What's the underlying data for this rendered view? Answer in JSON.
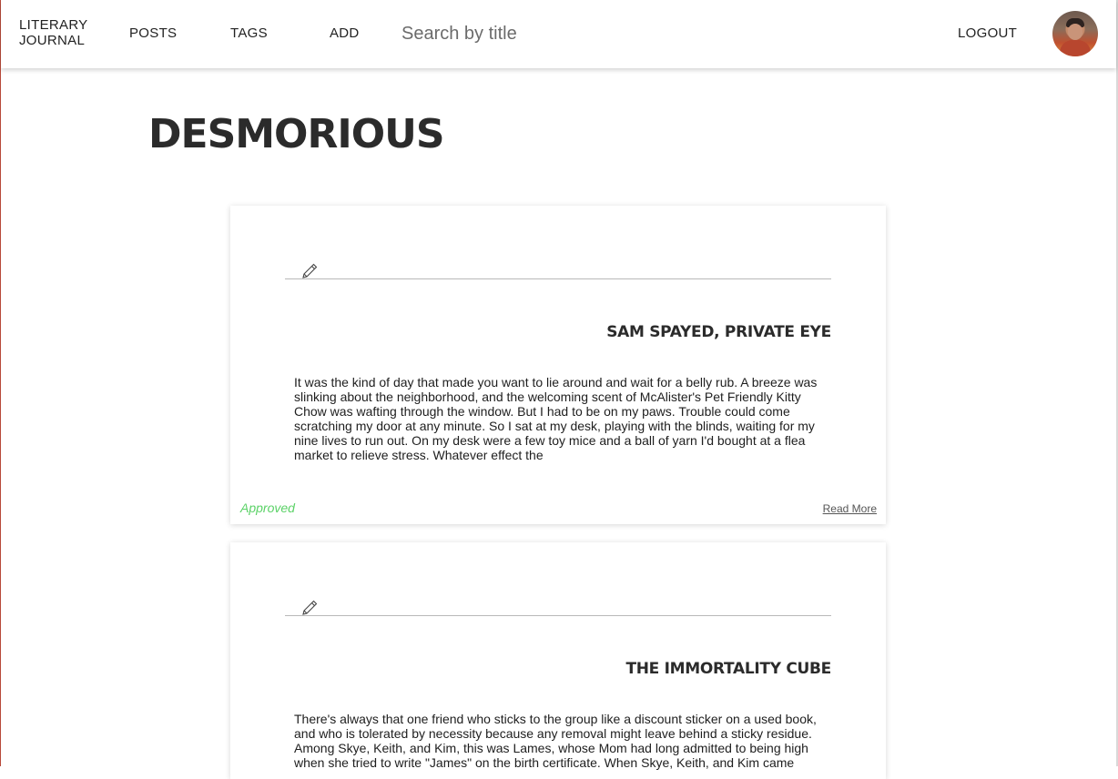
{
  "nav": {
    "brand": "LITERARY JOURNAL",
    "links": [
      {
        "label": "POSTS"
      },
      {
        "label": "TAGS"
      },
      {
        "label": "ADD"
      }
    ],
    "search_placeholder": "Search by title",
    "logout_label": "LOGOUT",
    "avatar_icon": "user-avatar"
  },
  "main": {
    "page_title": "DESMORIOUS"
  },
  "posts": [
    {
      "edit_icon": "pencil-icon",
      "title": "SAM SPAYED, PRIVATE EYE",
      "excerpt": "It was the kind of day that made you want to lie around and wait for a belly rub. A breeze was slinking about the neighborhood, and the welcoming scent of McAlister's Pet Friendly Kitty Chow was wafting through the window. But I had to be on my paws. Trouble could come scratching my door at any minute. So I sat at my desk, playing with the blinds, waiting for my nine lives to run out. On my desk were a few toy mice and a ball of yarn I'd bought at a flea market to relieve stress. Whatever effect the",
      "status": "Approved",
      "read_more": "Read More"
    },
    {
      "edit_icon": "pencil-icon",
      "title": "THE IMMORTALITY CUBE",
      "excerpt": "There's always that one friend who sticks to the group like a discount sticker on a used book, and who is tolerated by necessity because any removal might leave behind a sticky residue. Among Skye, Keith, and Kim, this was Lames, whose Mom had long admitted to being high when she tried to write \"James\" on the birth certificate. When Skye, Keith, and Kim came"
    }
  ],
  "colors": {
    "approved": "#5bd267",
    "title_text": "#2b2b2b",
    "rule": "#b8b8b8"
  }
}
